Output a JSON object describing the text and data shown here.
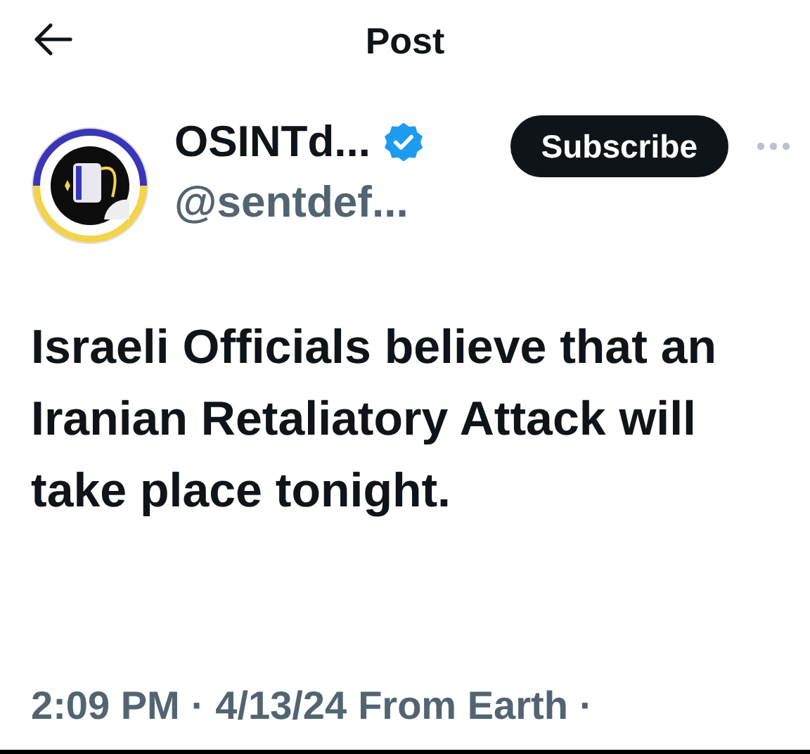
{
  "header": {
    "title": "Post"
  },
  "author": {
    "name": "OSINTd...",
    "verified": true,
    "handle": "@sentdef..."
  },
  "subscribe_button": {
    "label": "Subscribe"
  },
  "post": {
    "text": "Israeli Officials believe that an Iranian Retaliatory Attack will take place tonight."
  },
  "meta": {
    "time": "2:09 PM",
    "separator_1": "·",
    "date": "4/13/24",
    "source": "From Earth",
    "separator_2": "·"
  }
}
